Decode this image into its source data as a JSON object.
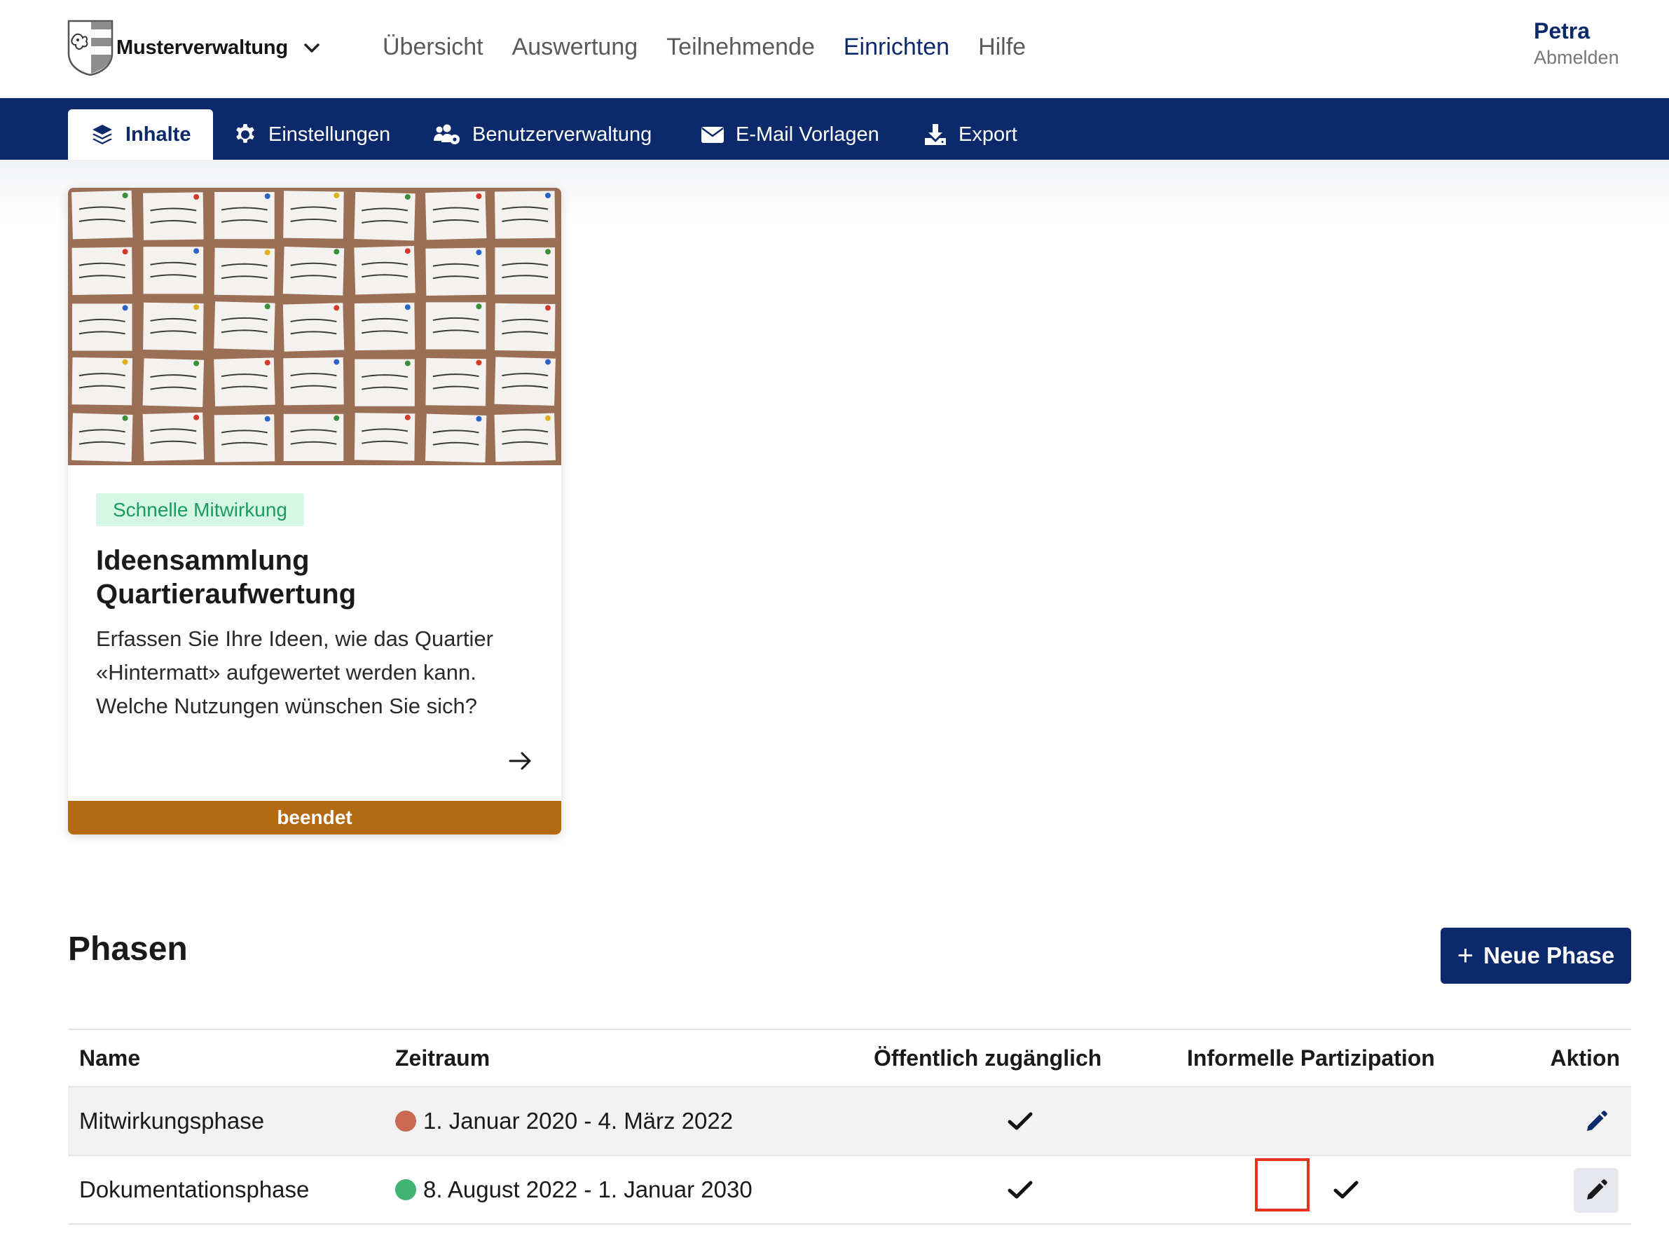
{
  "header": {
    "brand_name": "Musterverwaltung",
    "nav": [
      {
        "label": "Übersicht",
        "active": false
      },
      {
        "label": "Auswertung",
        "active": false
      },
      {
        "label": "Teilnehmende",
        "active": false
      },
      {
        "label": "Einrichten",
        "active": true
      },
      {
        "label": "Hilfe",
        "active": false
      }
    ],
    "user_name": "Petra",
    "logout_label": "Abmelden"
  },
  "subnav": {
    "tabs": [
      {
        "label": "Inhalte",
        "icon": "layers-icon",
        "active": true
      },
      {
        "label": "Einstellungen",
        "icon": "gear-icon",
        "active": false
      },
      {
        "label": "Benutzerverwaltung",
        "icon": "users-gear-icon",
        "active": false
      },
      {
        "label": "E-Mail Vorlagen",
        "icon": "envelope-icon",
        "active": false
      },
      {
        "label": "Export",
        "icon": "download-icon",
        "active": false
      }
    ]
  },
  "card": {
    "image": "pinboard-sticky-notes-photo",
    "badge": "Schnelle Mitwirkung",
    "title_line1": "Ideensammlung",
    "title_line2": "Quartieraufwertung",
    "desc_line1": "Erfassen Sie Ihre Ideen, wie das Quartier",
    "desc_line2": "«Hintermatt» aufgewertet werden kann.",
    "desc_line3": "Welche Nutzungen wünschen Sie sich?",
    "status": "beendet"
  },
  "phases": {
    "title": "Phasen",
    "new_button": "Neue Phase",
    "columns": [
      "Name",
      "Zeitraum",
      "Öffentlich zugänglich",
      "Informelle Partizipation",
      "Aktion"
    ],
    "rows": [
      {
        "name": "Mitwirkungsphase",
        "period": "1. Januar 2020 - 4. März 2022",
        "status_color": "#c96a50",
        "public": true,
        "informal": false
      },
      {
        "name": "Dokumentationsphase",
        "period": "8. August 2022 - 1. Januar 2030",
        "status_color": "#3fb372",
        "public": true,
        "informal": true
      }
    ]
  },
  "colors": {
    "primary": "#0c2a6b",
    "badge_bg": "#d5f7e6",
    "badge_text": "#1a9d5c",
    "status_ended": "#b36a10",
    "highlight": "#e8331c"
  }
}
